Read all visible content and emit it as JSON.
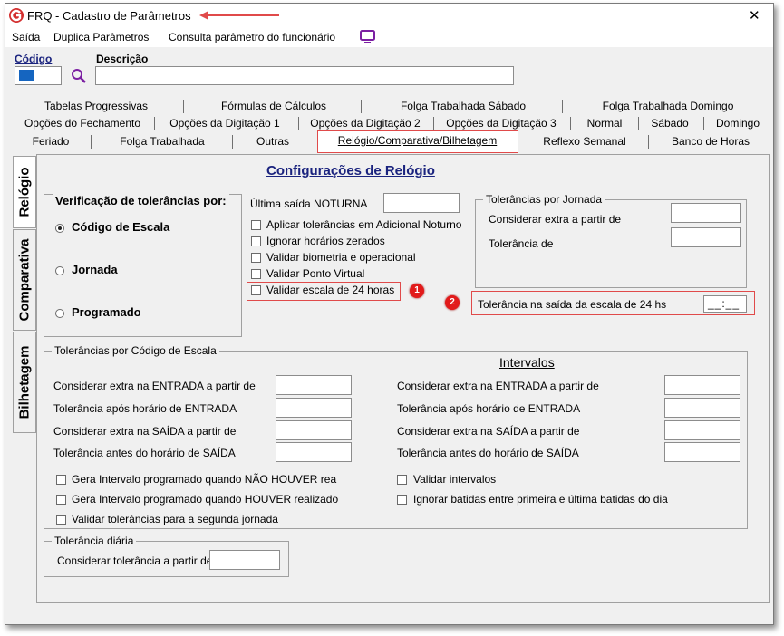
{
  "window": {
    "title": "FRQ - Cadastro de Parâmetros",
    "close": "✕"
  },
  "menu": {
    "items": [
      "Saída",
      "Duplica Parâmetros",
      "Consulta parâmetro do funcionário"
    ]
  },
  "header": {
    "codigo_label": "Código",
    "codigo_value": "",
    "descricao_label": "Descrição",
    "descricao_value": ""
  },
  "tabs": {
    "row1": [
      "Tabelas Progressivas",
      "Fórmulas de Cálculos",
      "Folga Trabalhada Sábado",
      "Folga Trabalhada Domingo"
    ],
    "row2": [
      "Opções do Fechamento",
      "Opções da Digitação 1",
      "Opções da Digitação 2",
      "Opções da Digitação 3",
      "Normal",
      "Sábado",
      "Domingo"
    ],
    "row3": [
      "Feriado",
      "Folga Trabalhada",
      "Outras",
      "Relógio/Comparativa/Bilhetagem",
      "Reflexo Semanal",
      "Banco de Horas"
    ]
  },
  "side_tabs": [
    "Relógio",
    "Comparativa",
    "Bilhetagem"
  ],
  "panel": {
    "title": "Configurações de Relógio",
    "verificacao": {
      "label": "Verificação de tolerâncias por:",
      "options": [
        "Código de Escala",
        "Jornada",
        "Programado"
      ],
      "selected": "Código de Escala"
    },
    "ultima_saida_label": "Última saída NOTURNA",
    "checkboxes": [
      "Aplicar tolerâncias em Adicional Noturno",
      "Ignorar horários zerados",
      "Validar biometria e operacional",
      "Validar Ponto Virtual",
      "Validar escala de 24 horas"
    ],
    "jornada": {
      "legend": "Tolerâncias por Jornada",
      "fields": [
        "Considerar extra a partir de",
        "Tolerância de"
      ]
    },
    "tol24": {
      "label": "Tolerância na saída da escala de 24 hs",
      "value": "__:__"
    },
    "badges": [
      "1",
      "2"
    ],
    "escala": {
      "legend": "Tolerâncias por Código de Escala",
      "intervalos_title": "Intervalos",
      "left_fields": [
        "Considerar extra na ENTRADA a partir de",
        "Tolerância após horário de ENTRADA",
        "Considerar extra na SAÍDA a partir de",
        "Tolerância antes do horário de SAÍDA"
      ],
      "right_fields": [
        "Considerar extra na ENTRADA a partir de",
        "Tolerância após horário de ENTRADA",
        "Considerar extra na SAÍDA a partir de",
        "Tolerância antes do horário de SAÍDA"
      ],
      "left_checks": [
        "Gera Intervalo programado quando NÃO HOUVER rea",
        "Gera Intervalo programado quando HOUVER realizado",
        "Validar tolerâncias para a segunda jornada"
      ],
      "right_checks": [
        "Validar intervalos",
        "Ignorar batidas entre primeira e última batidas do dia"
      ]
    },
    "diaria": {
      "legend": "Tolerância diária",
      "label": "Considerar tolerância a partir de"
    }
  },
  "colors": {
    "accent": "#1a237e",
    "annotation": "#e04a4a",
    "badge": "#e21a1a",
    "logo": "#d32f2f",
    "monitor_icon": "#7b1fa2"
  }
}
